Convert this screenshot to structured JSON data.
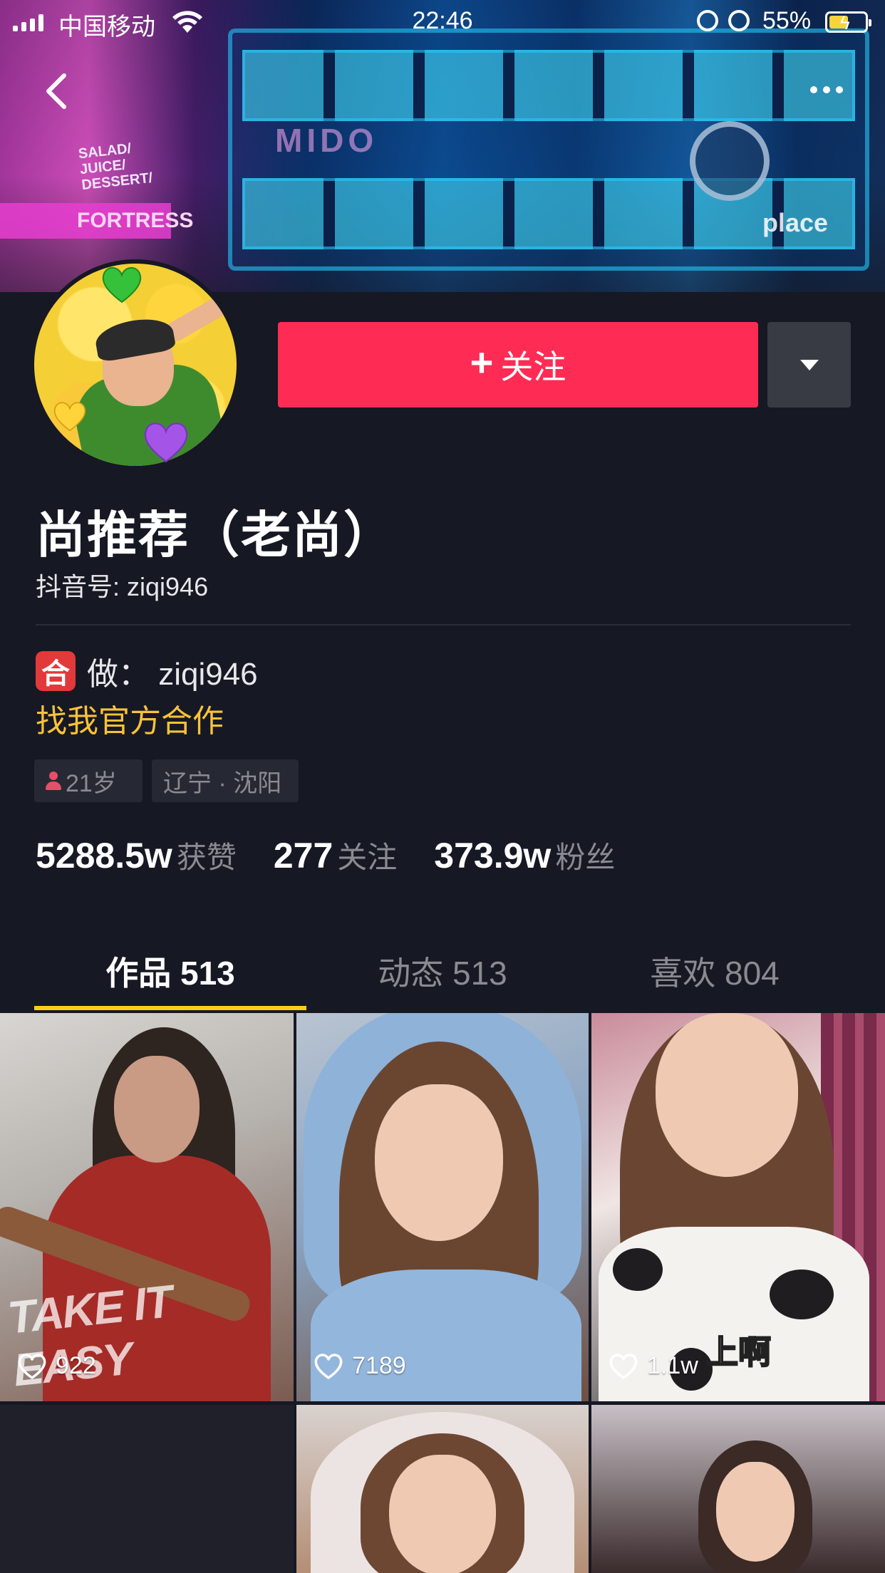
{
  "status_bar": {
    "carrier": "中国移动",
    "time": "22:46",
    "battery_percent": "55%",
    "battery_level": 0.55,
    "icons": [
      "signal-icon",
      "wifi-icon",
      "alarm-icon",
      "rotation-lock-icon",
      "battery-charging-icon"
    ]
  },
  "cover": {
    "signs": {
      "salad": "SALAD/\nJUICE/\nDESSERT/",
      "fortress": "FORTRESS",
      "mido": "MIDO",
      "place": "place"
    }
  },
  "nav": {
    "back_icon": "chevron-left-icon",
    "more_icon": "more-dots-icon"
  },
  "profile": {
    "follow_label": "关注",
    "follow_plus": "+",
    "name": "尚推荐（老尚）",
    "douyin_id": "抖音号: ziqi946",
    "bio_badge": "合",
    "bio_line1": "做：  ziqi946",
    "bio_line2": "找我官方合作",
    "tags": {
      "age": "21岁",
      "location": "辽宁 · 沈阳"
    },
    "stats": [
      {
        "value": "5288.5w",
        "label": "获赞"
      },
      {
        "value": "277",
        "label": "关注"
      },
      {
        "value": "373.9w",
        "label": "粉丝"
      }
    ]
  },
  "tabs": [
    {
      "label": "作品 513",
      "active": true
    },
    {
      "label": "动态 513",
      "active": false
    },
    {
      "label": "喜欢 804",
      "active": false
    }
  ],
  "colors": {
    "background": "#161823",
    "follow_button": "#fe2c55",
    "accent_yellow": "#face15",
    "bio_link": "#f8c23a"
  },
  "videos": [
    {
      "likes": "922",
      "overlay_text": "TAKE IT EASY"
    },
    {
      "likes": "7189"
    },
    {
      "likes": "1.1w",
      "overlay_text": "上啊"
    },
    {
      "likes": ""
    },
    {
      "likes": ""
    },
    {
      "likes": ""
    }
  ]
}
